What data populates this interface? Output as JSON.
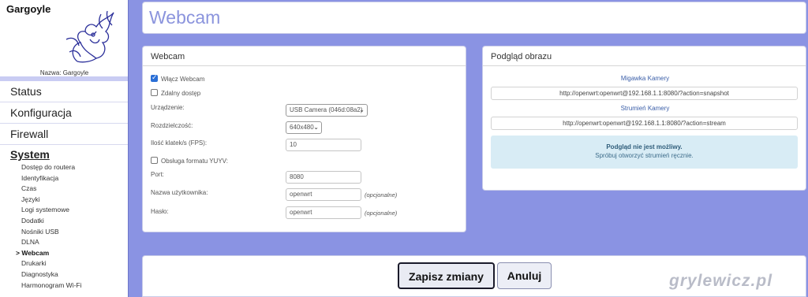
{
  "app": {
    "name": "Gargoyle",
    "device_label": "Nazwa: Gargoyle"
  },
  "nav": [
    {
      "label": "Status"
    },
    {
      "label": "Konfiguracja"
    },
    {
      "label": "Firewall"
    },
    {
      "label": "System"
    }
  ],
  "system_items": [
    {
      "label": "Dostęp do routera"
    },
    {
      "label": "Identyfikacja"
    },
    {
      "label": "Czas"
    },
    {
      "label": "Języki"
    },
    {
      "label": "Logi systemowe"
    },
    {
      "label": "Dodatki"
    },
    {
      "label": "Nośniki USB"
    },
    {
      "label": "DLNA"
    },
    {
      "label": "> Webcam"
    },
    {
      "label": "Drukarki"
    },
    {
      "label": "Diagnostyka"
    },
    {
      "label": "Harmonogram Wi-Fi"
    }
  ],
  "page": {
    "title": "Webcam"
  },
  "webcam": {
    "heading": "Webcam",
    "enable_label": "Włącz Webcam",
    "enable_checked": true,
    "remote_label": "Zdalny dostęp",
    "remote_checked": false,
    "device_label": "Urządzenie:",
    "device_value": "USB Camera (046d:08a2)",
    "resolution_label": "Rozdzielczość:",
    "resolution_value": "640x480",
    "fps_label": "Ilość klatek/s (FPS):",
    "fps_value": "10",
    "yuyv_label": "Obsługa formatu YUYV:",
    "yuyv_checked": false,
    "port_label": "Port:",
    "port_value": "8080",
    "user_label": "Nazwa użytkownika:",
    "user_value": "openwrt",
    "user_hint": "(opcjonalne)",
    "pass_label": "Hasło:",
    "pass_value": "openwrt",
    "pass_hint": "(opcjonalne)"
  },
  "preview": {
    "heading": "Podgląd obrazu",
    "snapshot_label": "Migawka Kamery",
    "snapshot_url": "http://openwrt:openwrt@192.168.1.1:8080/?action=snapshot",
    "stream_label": "Strumień Kamery",
    "stream_url": "http://openwrt:openwrt@192.168.1.1:8080/?action=stream",
    "info_title": "Podgląd nie jest możliwy.",
    "info_sub": "Spróbuj otworzyć strumień ręcznie."
  },
  "actions": {
    "save": "Zapisz zmiany",
    "cancel": "Anuluj"
  },
  "watermark": "grylewicz.pl"
}
